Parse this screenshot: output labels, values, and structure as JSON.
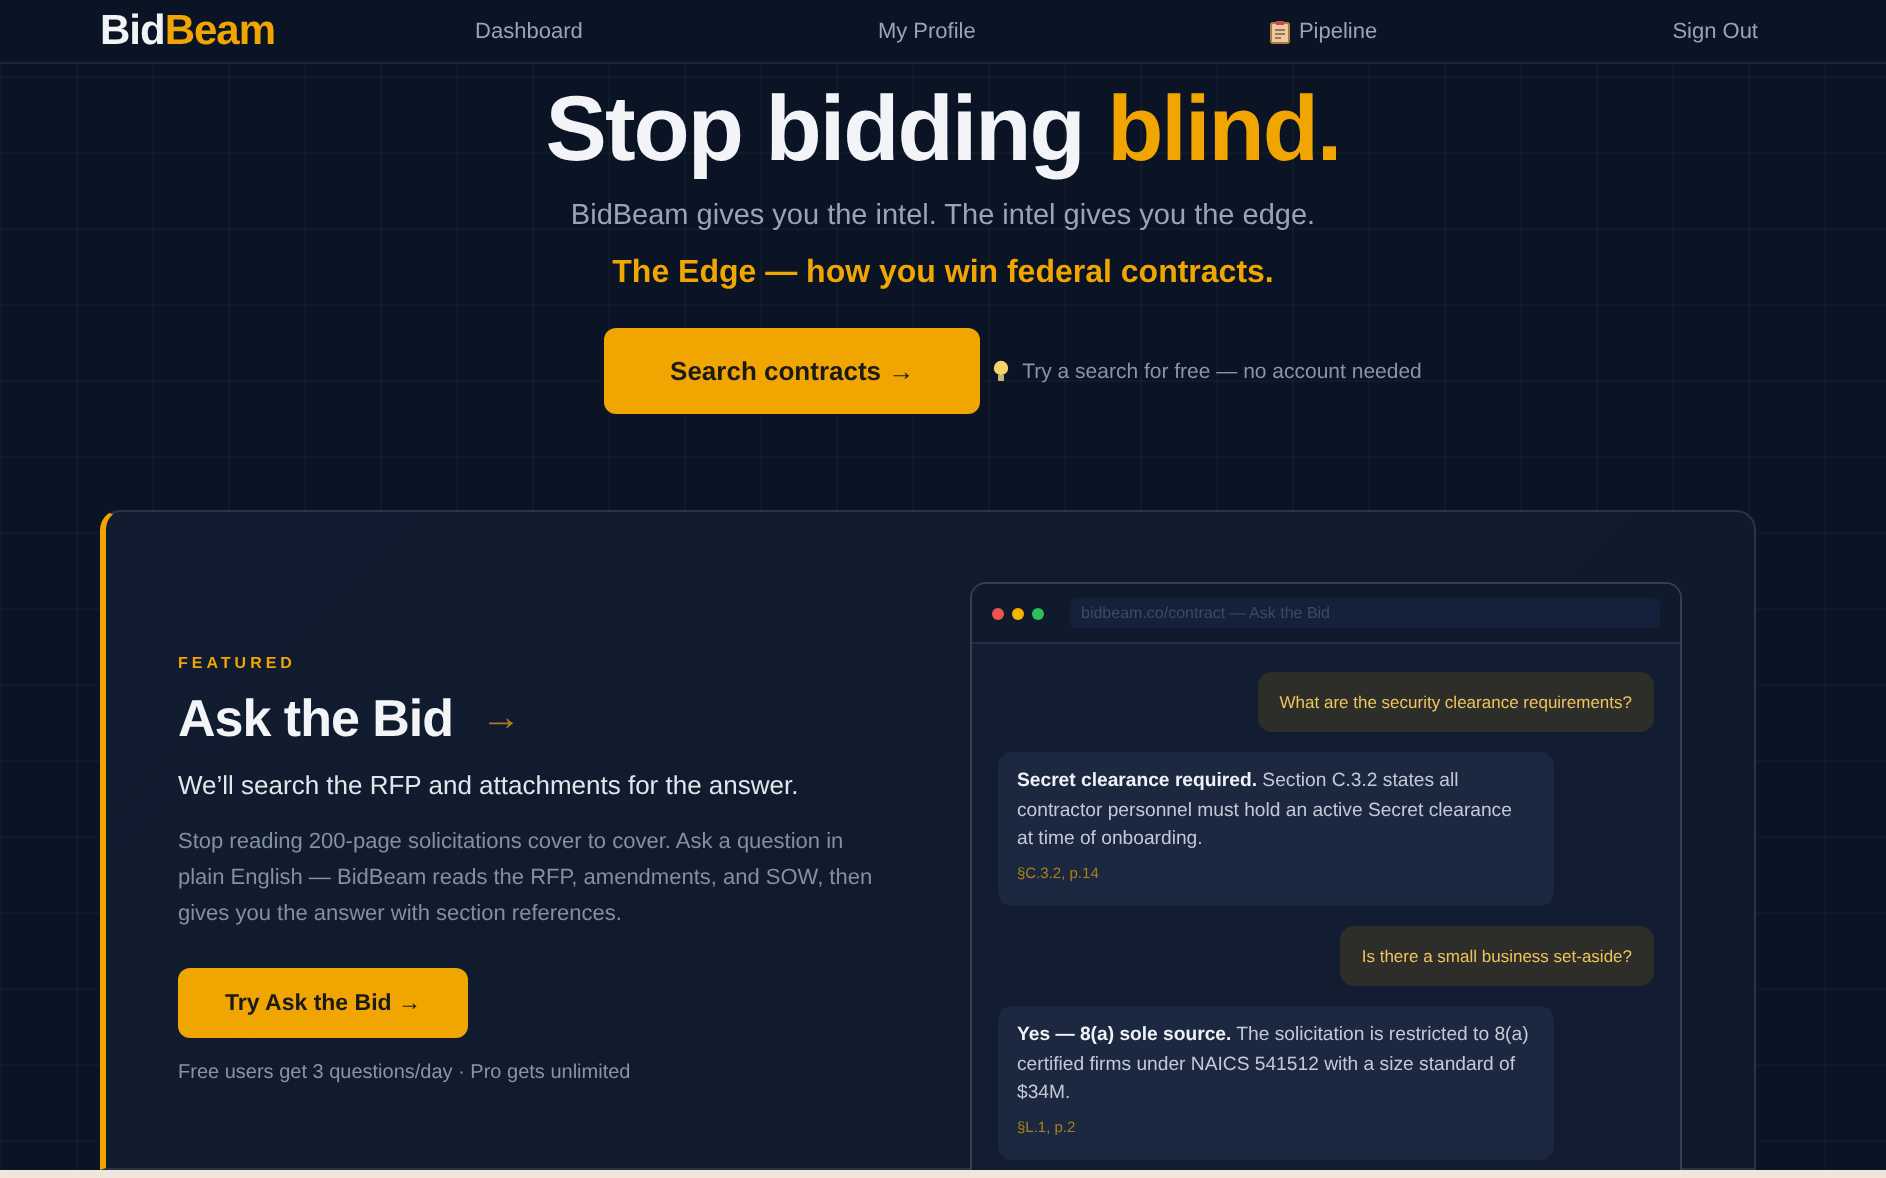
{
  "nav": {
    "logo_lead": "Bid",
    "logo_accent": "Beam",
    "links": [
      {
        "label": "Dashboard",
        "icon": false
      },
      {
        "label": "My Profile",
        "icon": false
      },
      {
        "label": "Pipeline",
        "icon": true
      },
      {
        "label": "Sign Out",
        "icon": false
      }
    ]
  },
  "hero": {
    "headline_lead": "Stop bidding",
    "headline_accent": "blind.",
    "subtitle": "BidBeam gives you the intel. The intel gives you the edge.",
    "tagline": "The Edge — how you win federal contracts.",
    "button": "Search contracts →",
    "hint": "Try a search for free — no account needed"
  },
  "feature": {
    "eyebrow": "FEATURED",
    "title": "Ask the Bid",
    "title_arrow": "→",
    "lead": "We’ll search the RFP and attachments for the answer.",
    "body": "Stop reading 200-page solicitations cover to cover. Ask a question in plain English — BidBeam reads the RFP, amendments, and SOW, then gives you the answer with section references.",
    "button": "Try Ask the Bid →",
    "note": "Free users get 3 questions/day · Pro gets unlimited",
    "preview": {
      "address": "bidbeam.co/contract — Ask the Bid",
      "messages": [
        {
          "kind": "question",
          "text": "What are the security clearance requirements?"
        },
        {
          "kind": "answer",
          "text": "**Secret clearance required.** Section C.3.2 states all contractor personnel must hold an active Secret clearance at time of onboarding.",
          "ref": "§C.3.2, p.14"
        },
        {
          "kind": "question",
          "text": "Is there a small business set-aside?"
        },
        {
          "kind": "answer",
          "text": "**Yes — 8(a) sole source.** The solicitation is restricted to 8(a) certified firms under NAICS 541512 with a size standard of $34M.",
          "ref": "§L.1, p.2"
        }
      ]
    }
  }
}
